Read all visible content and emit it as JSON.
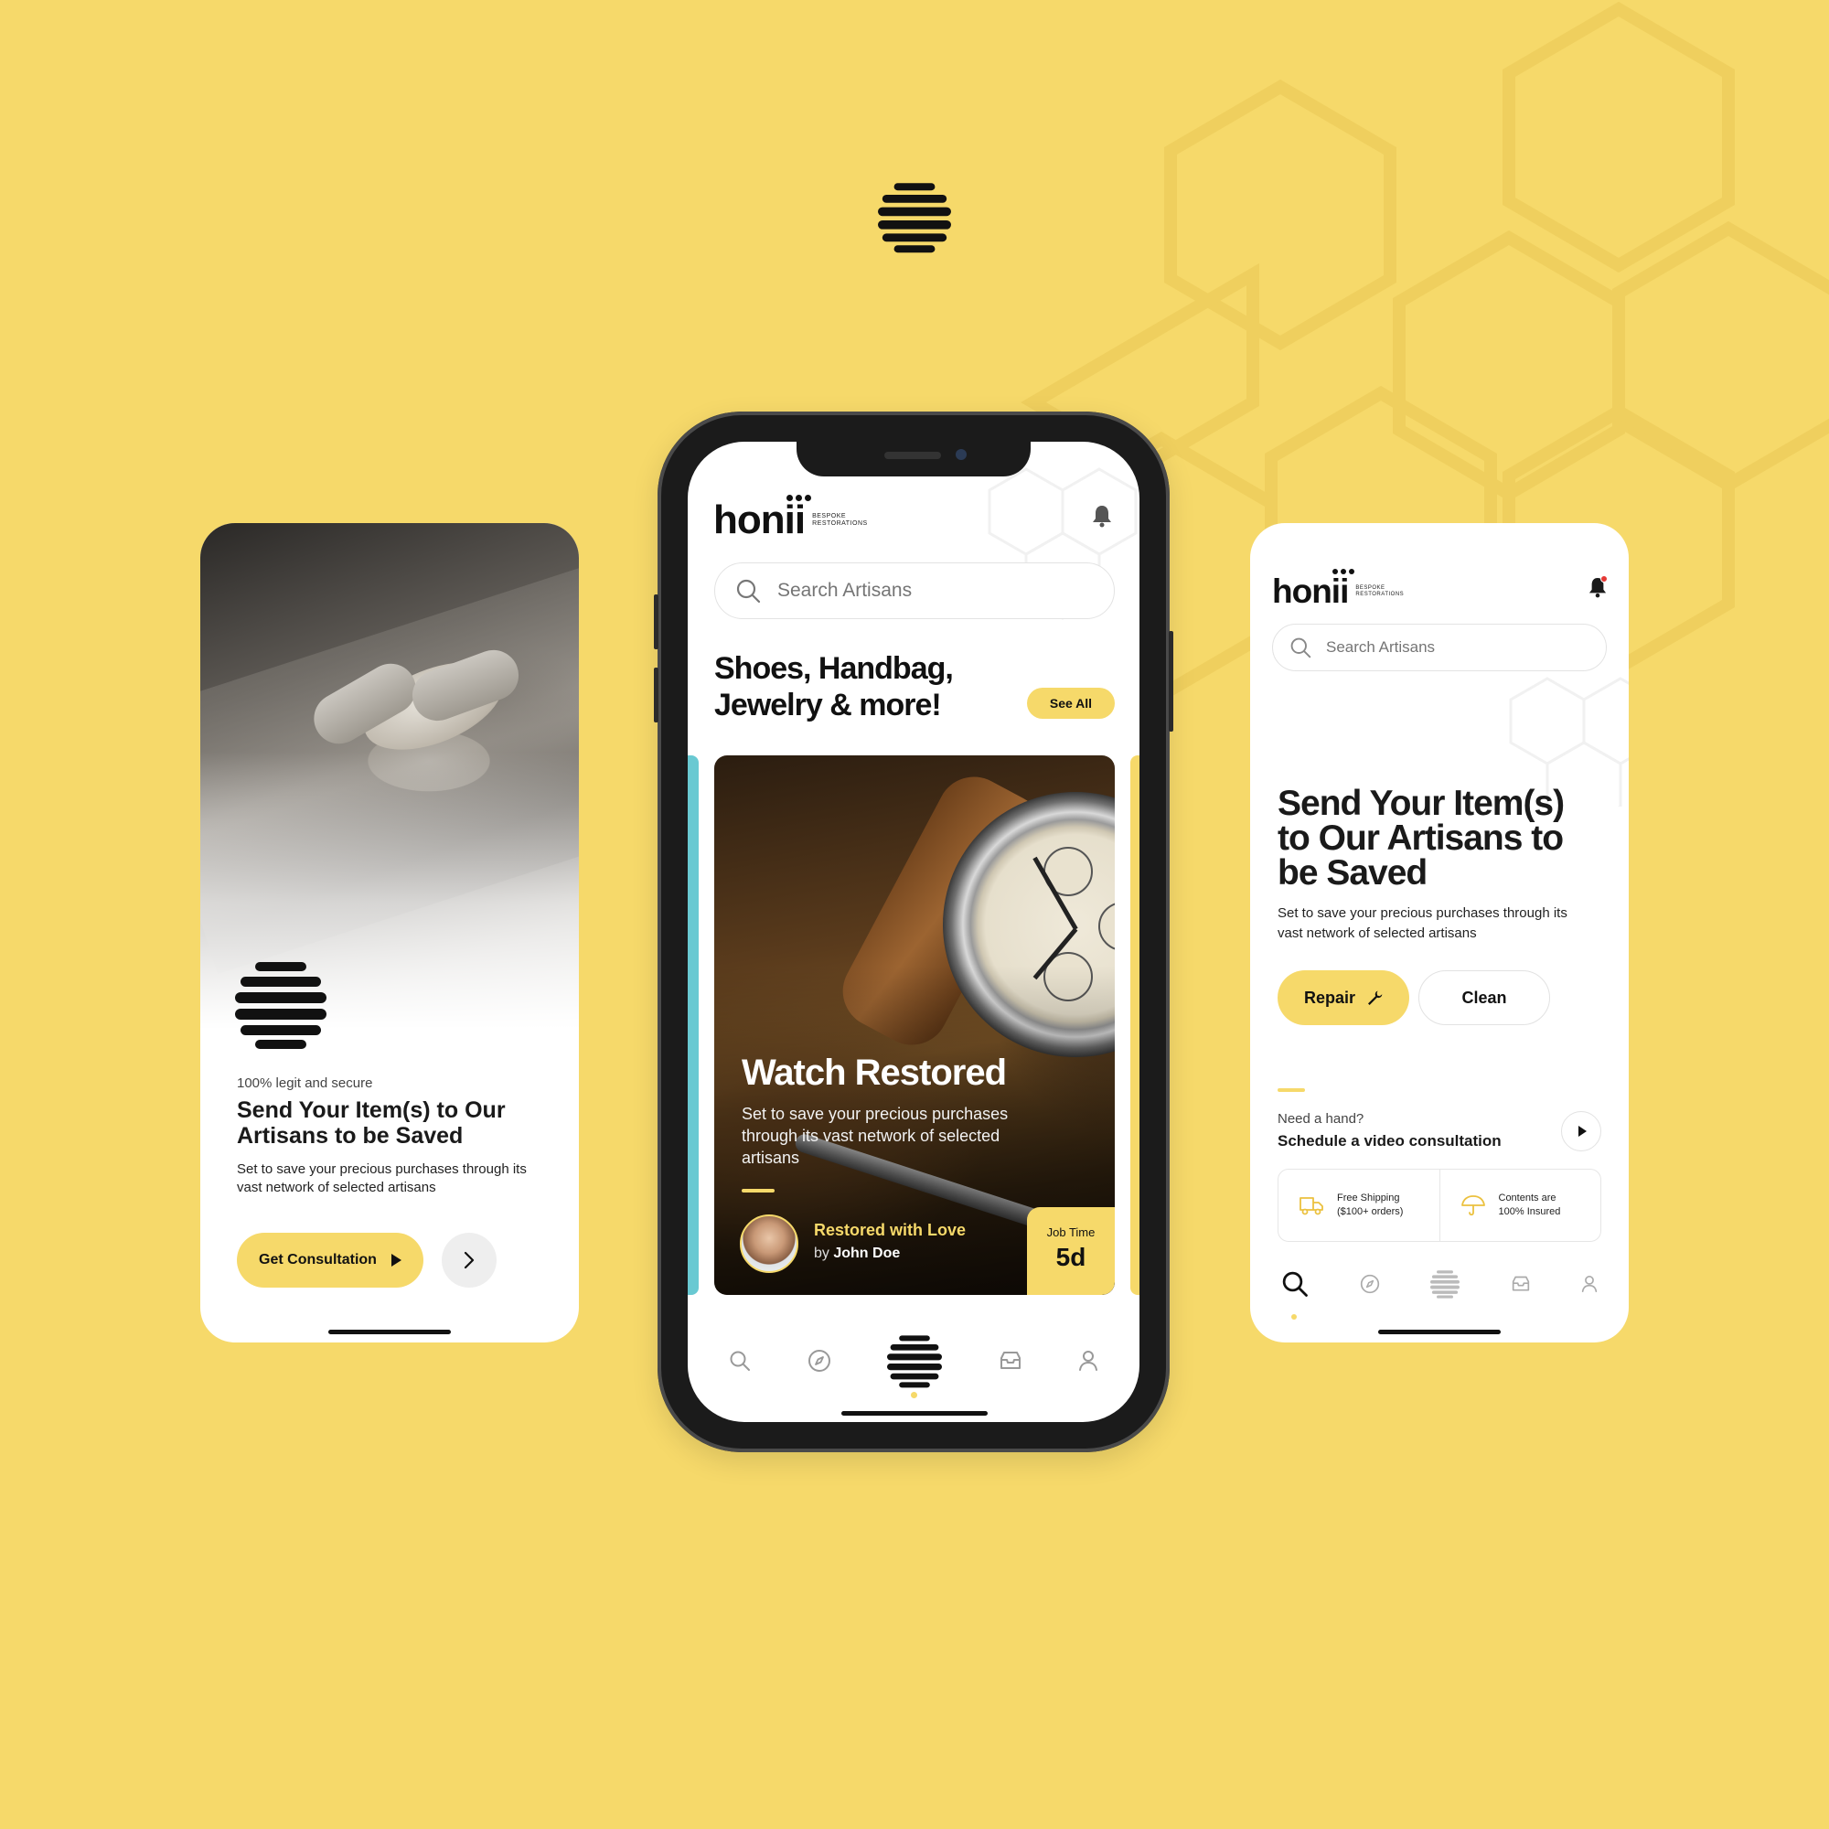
{
  "left_screen": {
    "eyebrow": "100% legit and secure",
    "title": "Send Your Item(s) to Our Artisans to be Saved",
    "description": "Set to save your precious purchases through its vast network of selected artisans",
    "cta_label": "Get Consultation"
  },
  "brand": {
    "name": "honii",
    "tagline_line1": "BESPOKE",
    "tagline_line2": "RESTORATIONS"
  },
  "center_screen": {
    "search_placeholder": "Search Artisans",
    "heading": "Shoes, Handbag, Jewelry & more!",
    "see_all_label": "See All",
    "feature_card": {
      "title": "Watch Restored",
      "description": "Set to save your precious purchases through its vast network of selected artisans",
      "artisan_tagline": "Restored with Love",
      "artisan_by": "by",
      "artisan_name": "John Doe",
      "job_time_label": "Job Time",
      "job_time_value": "5d"
    },
    "tabs": [
      "search-icon",
      "compass-icon",
      "home-logo-icon",
      "inbox-icon",
      "profile-icon"
    ],
    "active_tab": "home-logo-icon"
  },
  "right_screen": {
    "search_placeholder": "Search Artisans",
    "title": "Send Your Item(s) to Our Artisans to be Saved",
    "description": "Set to save your precious purchases through its vast network of selected artisans",
    "repair_label": "Repair",
    "clean_label": "Clean",
    "help_question": "Need a hand?",
    "help_link": "Schedule a video consultation",
    "perks": [
      {
        "icon": "truck-icon",
        "line1": "Free Shipping",
        "line2": "($100+ orders)"
      },
      {
        "icon": "umbrella-icon",
        "line1": "Contents are",
        "line2": "100% Insured"
      }
    ],
    "active_tab": "search-icon"
  },
  "colors": {
    "background": "#F6D96A",
    "accent": "#F6D96A",
    "text": "#1a1a1a",
    "teal_card": "#69C9D2",
    "notification_dot": "#E53935"
  }
}
